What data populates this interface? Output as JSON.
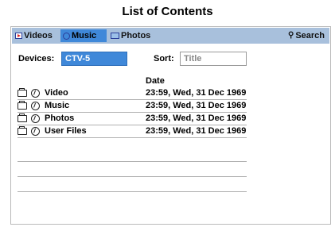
{
  "page": {
    "title": "List of Contents"
  },
  "tabs": {
    "videos": {
      "label": "Videos",
      "icon": "video-icon"
    },
    "music": {
      "label": "Music",
      "icon": "music-icon",
      "selected": true
    },
    "photos": {
      "label": "Photos",
      "icon": "photo-icon"
    },
    "search": {
      "label": "Search",
      "icon": "search-icon"
    }
  },
  "devices": {
    "label": "Devices:",
    "value": "CTV-5"
  },
  "sort": {
    "label": "Sort:",
    "value": "Title"
  },
  "table": {
    "date_header": "Date",
    "rows": [
      {
        "name": "Video",
        "date": "23:59, Wed, 31 Dec 1969"
      },
      {
        "name": "Music",
        "date": "23:59, Wed, 31 Dec 1969"
      },
      {
        "name": "Photos",
        "date": "23:59, Wed, 31 Dec 1969"
      },
      {
        "name": "User Files",
        "date": "23:59, Wed, 31 Dec 1969"
      }
    ]
  },
  "colors": {
    "tab_bar": "#a8c0dc",
    "selected": "#3f88d9"
  }
}
